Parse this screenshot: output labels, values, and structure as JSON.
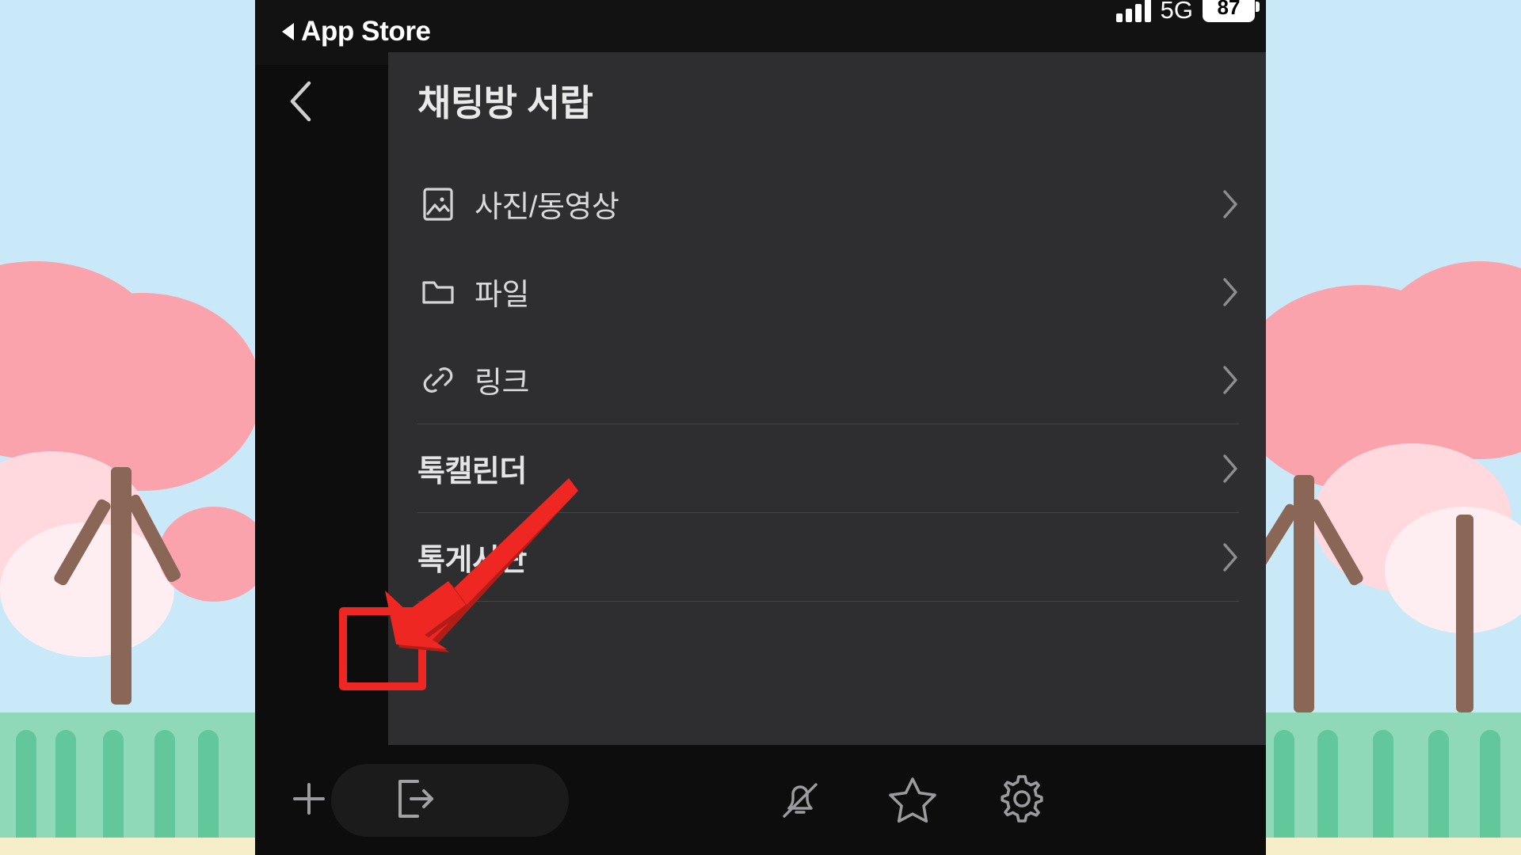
{
  "statusbar": {
    "back_label": "App Store",
    "back_icon": "triangle-left-icon",
    "signal_icon": "cellular-signal-icon",
    "network": "5G",
    "battery_level": "87",
    "battery_icon": "battery-icon"
  },
  "drawer": {
    "title": "채팅방 서랍",
    "back_icon": "chevron-left-icon",
    "items": [
      {
        "label": "사진/동영상",
        "icon": "photo-video-icon",
        "bold": false,
        "divider_after": false
      },
      {
        "label": "파일",
        "icon": "folder-icon",
        "bold": false,
        "divider_after": false
      },
      {
        "label": "링크",
        "icon": "link-icon",
        "bold": false,
        "divider_after": true
      },
      {
        "label": "톡캘린더",
        "icon": "none",
        "bold": true,
        "divider_after": true
      },
      {
        "label": "톡게시판",
        "icon": "none",
        "bold": true,
        "divider_after": true
      }
    ],
    "chevron_icon": "chevron-right-icon"
  },
  "toolbar": {
    "items": [
      {
        "name": "add-button",
        "icon": "plus-icon"
      },
      {
        "name": "leave-chat-button",
        "icon": "exit-arrow-icon"
      },
      {
        "name": "mute-button",
        "icon": "bell-off-icon"
      },
      {
        "name": "favorite-button",
        "icon": "star-icon"
      },
      {
        "name": "settings-button",
        "icon": "gear-icon"
      }
    ]
  },
  "annotation": {
    "highlight_color": "#ee2722",
    "arrow_icon": "arrow-down-left-icon",
    "target": "leave-chat-button"
  },
  "wallpaper": {
    "sky_color": "#c9e9f8",
    "blossom_color": "#faa3ad",
    "ground_color": "#8fd8b8",
    "trunk_color": "#8a6657"
  }
}
